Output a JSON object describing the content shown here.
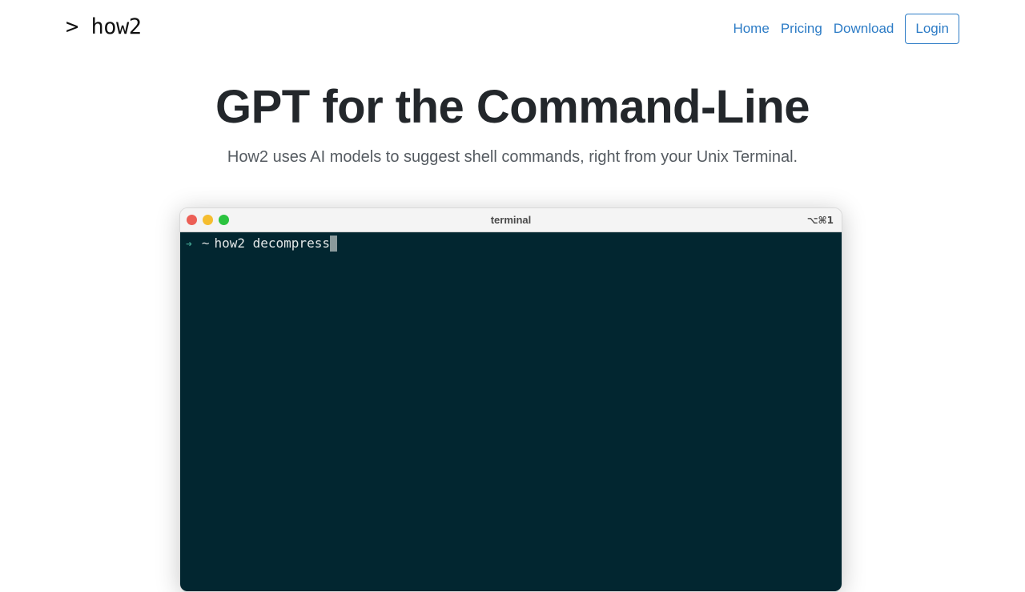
{
  "brand": {
    "text": "> how2"
  },
  "nav": {
    "links": [
      {
        "label": "Home"
      },
      {
        "label": "Pricing"
      },
      {
        "label": "Download"
      }
    ],
    "login_label": "Login"
  },
  "hero": {
    "title": "GPT for the Command-Line",
    "subtitle": "How2 uses AI models to suggest shell commands, right from your Unix Terminal."
  },
  "terminal": {
    "title": "terminal",
    "shortcut": "⌥⌘1",
    "prompt_arrow": "➜",
    "prompt_dir": "~",
    "command": "how2 decompress"
  },
  "colors": {
    "accent": "#2d7cc6",
    "terminal_bg": "#022630"
  }
}
